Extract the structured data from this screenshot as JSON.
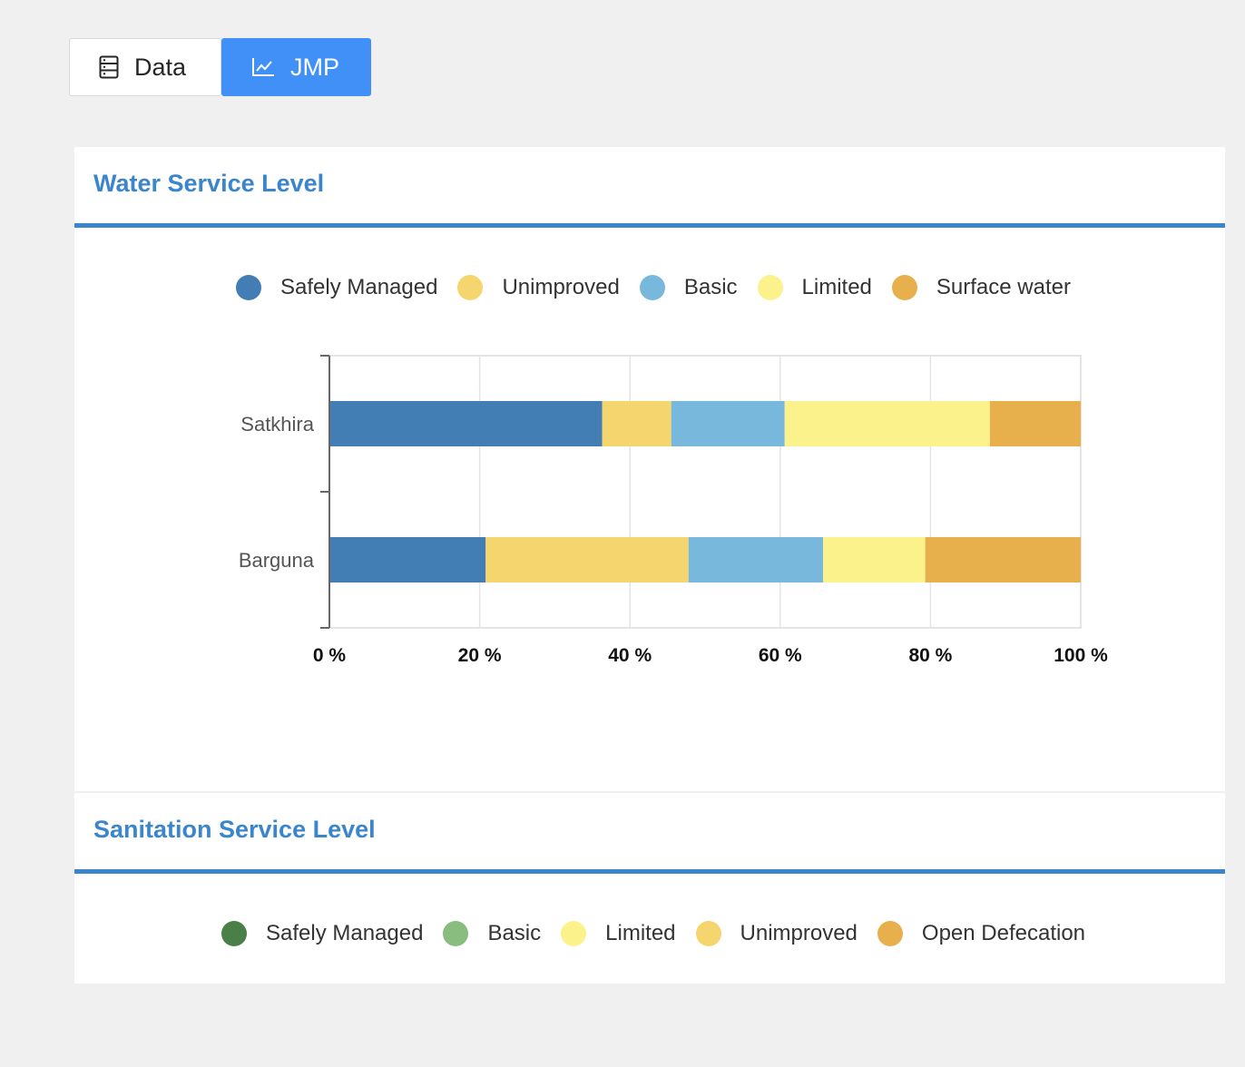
{
  "tabs": [
    {
      "label": "Data",
      "icon": "table-icon",
      "active": false
    },
    {
      "label": "JMP",
      "icon": "line-chart-icon",
      "active": true
    }
  ],
  "water": {
    "title": "Water Service Level",
    "legend": [
      {
        "label": "Safely Managed",
        "color": "#427db4"
      },
      {
        "label": "Unimproved",
        "color": "#f5d56d"
      },
      {
        "label": "Basic",
        "color": "#78b8dd"
      },
      {
        "label": "Limited",
        "color": "#fcf28b"
      },
      {
        "label": "Surface water",
        "color": "#e7b04c"
      }
    ]
  },
  "sanitation": {
    "title": "Sanitation Service Level",
    "legend": [
      {
        "label": "Safely Managed",
        "color": "#4a7f48"
      },
      {
        "label": "Basic",
        "color": "#89bc7f"
      },
      {
        "label": "Limited",
        "color": "#fcf28b"
      },
      {
        "label": "Unimproved",
        "color": "#f5d56d"
      },
      {
        "label": "Open Defecation",
        "color": "#e7b04c"
      }
    ]
  },
  "chart_data": {
    "type": "bar",
    "orientation": "horizontal",
    "stacked": true,
    "title": "Water Service Level",
    "categories": [
      "Satkhira",
      "Barguna"
    ],
    "x_ticks": [
      "0 %",
      "20 %",
      "40 %",
      "60 %",
      "80 %",
      "100 %"
    ],
    "xlim": [
      0,
      100
    ],
    "grid": true,
    "legend_position": "top",
    "series": [
      {
        "name": "Safely Managed",
        "color": "#427db4",
        "values": [
          36.3,
          20.8
        ]
      },
      {
        "name": "Unimproved",
        "color": "#f5d56d",
        "values": [
          9.2,
          27.0
        ]
      },
      {
        "name": "Basic",
        "color": "#78b8dd",
        "values": [
          15.1,
          17.9
        ]
      },
      {
        "name": "Limited",
        "color": "#fcf28b",
        "values": [
          27.3,
          13.6
        ]
      },
      {
        "name": "Surface water",
        "color": "#e7b04c",
        "values": [
          12.1,
          20.7
        ]
      }
    ]
  }
}
